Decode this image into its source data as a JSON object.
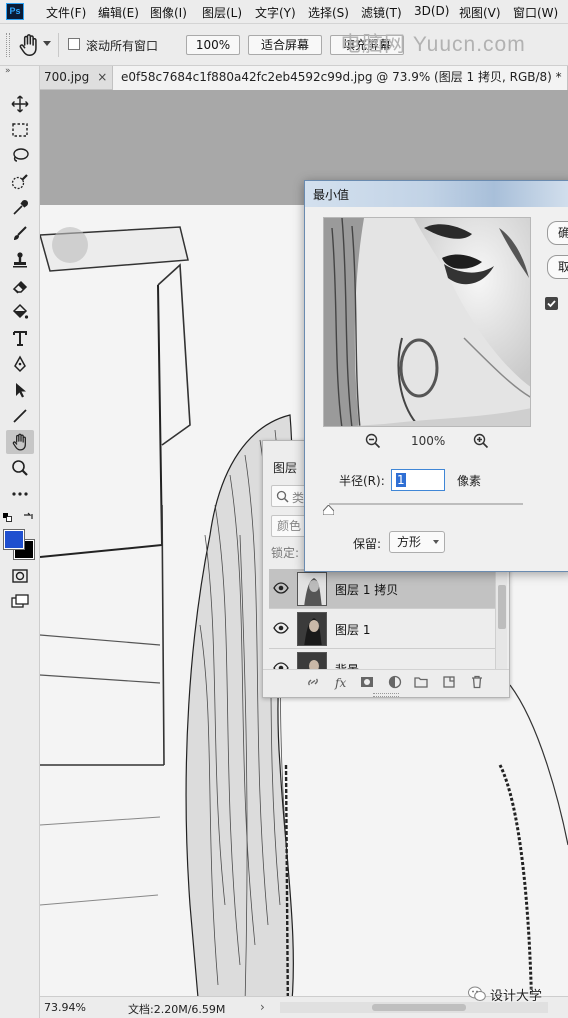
{
  "app": {
    "logo": "Ps",
    "menu": [
      "文件(F)",
      "编辑(E)",
      "图像(I)",
      "图层(L)",
      "文字(Y)",
      "选择(S)",
      "滤镜(T)",
      "3D(D)",
      "视图(V)",
      "窗口(W)"
    ]
  },
  "options": {
    "scroll_all_windows": "滚动所有窗口",
    "zoom_value": "100%",
    "fit_screen": "适合屏幕",
    "fill_screen": "填充屏幕"
  },
  "watermark": "电脑网 Yuucn.com",
  "tabs": [
    {
      "label": "700.jpg",
      "close": "×"
    },
    {
      "label": "e0f58c7684c1f880a42fc2eb4592c99d.jpg @ 73.9% (图层 1 拷贝, RGB/8) *",
      "close": "×"
    }
  ],
  "tools": [
    "move-icon",
    "marquee-icon",
    "lasso-icon",
    "quick-select-icon",
    "eyedropper-icon",
    "brush-icon",
    "stamp-icon",
    "eraser-icon",
    "paint-bucket-icon",
    "type-icon",
    "pen-icon",
    "path-select-icon",
    "line-icon",
    "hand-icon",
    "zoom-icon",
    "more-tools-icon"
  ],
  "colors": {
    "foreground": "#1f4fcf",
    "background": "#000000"
  },
  "layers_panel": {
    "title": "图层",
    "search_placeholder": "类",
    "blend_mode": "颜色",
    "lock_label": "锁定:",
    "layers": [
      {
        "name": "图层 1 拷贝",
        "visible": true,
        "selected": true
      },
      {
        "name": "图层 1",
        "visible": true,
        "selected": false
      },
      {
        "name": "背景",
        "visible": true,
        "selected": false
      }
    ]
  },
  "minimum_dialog": {
    "title": "最小值",
    "zoom": "100%",
    "radius_label": "半径(R):",
    "radius_value": "1",
    "radius_unit": "像素",
    "preserve_label": "保留:",
    "preserve_value": "方形",
    "ok_label": "确",
    "cancel_label": "取"
  },
  "status": {
    "zoom": "73.94%",
    "doc_size": "文档:2.20M/6.59M",
    "arrow": "›"
  },
  "wechat_badge": "设计大学"
}
